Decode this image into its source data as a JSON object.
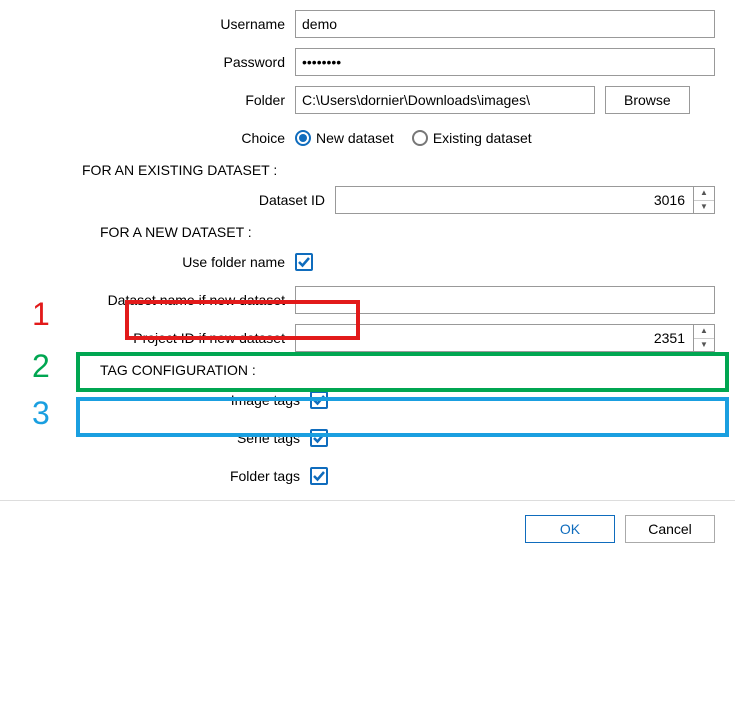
{
  "annotations": {
    "1": "1",
    "2": "2",
    "3": "3"
  },
  "form": {
    "username_label": "Username",
    "username_value": "demo",
    "password_label": "Password",
    "password_value": "••••••••",
    "folder_label": "Folder",
    "folder_value": "C:\\Users\\dornier\\Downloads\\images\\",
    "browse_label": "Browse",
    "choice_label": "Choice",
    "choice_new": "New dataset",
    "choice_existing": "Existing dataset"
  },
  "existing": {
    "heading": "FOR AN EXISTING DATASET :",
    "dataset_id_label": "Dataset ID",
    "dataset_id_value": "3016"
  },
  "newds": {
    "heading": "FOR A NEW DATASET :",
    "use_folder_label": "Use folder name",
    "name_label": "Dataset name if new dataset",
    "name_value": "",
    "project_id_label": "Project ID if new dataset",
    "project_id_value": "2351"
  },
  "tags": {
    "heading": "TAG CONFIGURATION :",
    "image_label": "Image tags",
    "serie_label": "Serie tags",
    "folder_label": "Folder tags"
  },
  "footer": {
    "ok": "OK",
    "cancel": "Cancel"
  }
}
